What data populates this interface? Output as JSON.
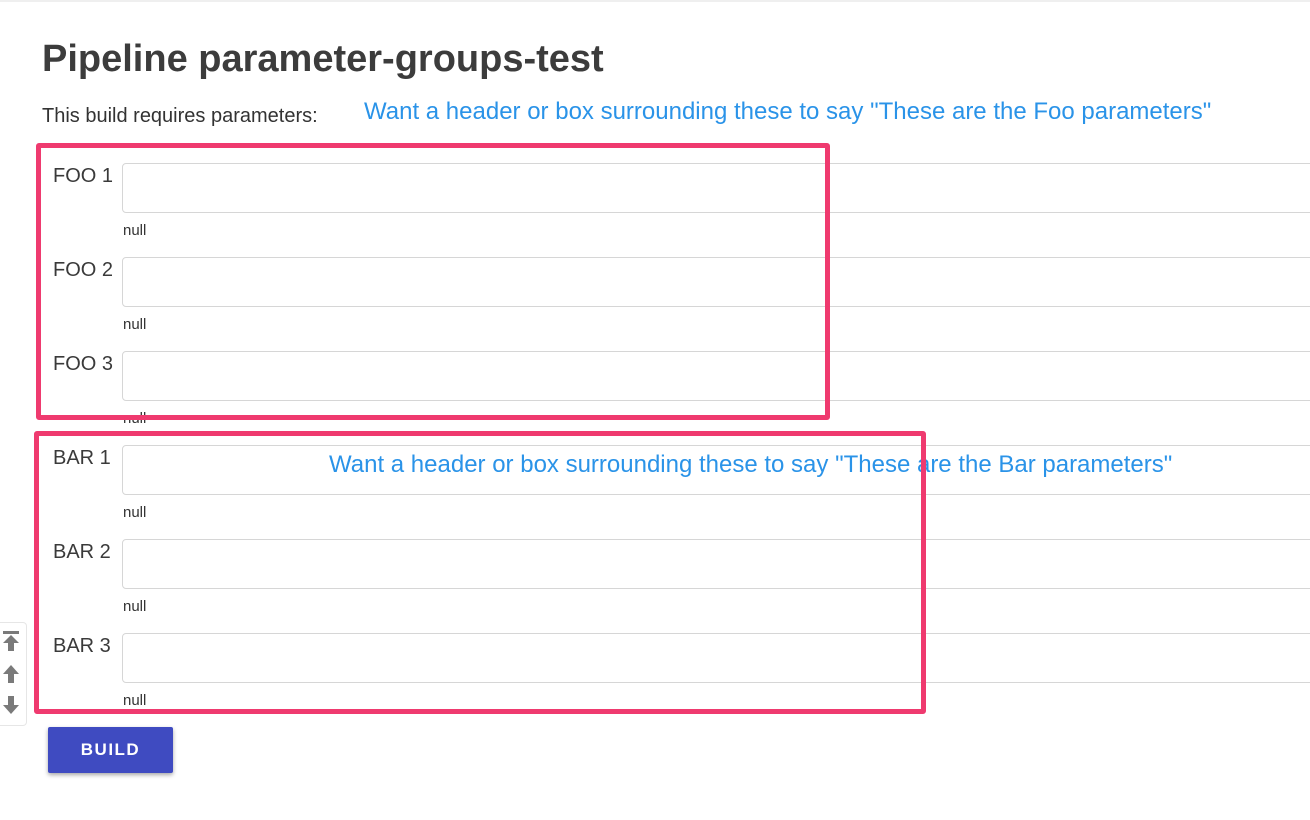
{
  "page": {
    "title": "Pipeline parameter-groups-test",
    "intro": "This build requires parameters:"
  },
  "annotations": {
    "foo": "Want a header or box surrounding these to say \"These are the Foo parameters\"",
    "bar": "Want a header or box surrounding these to say \"These are the Bar parameters\"",
    "color": "#2a93e8",
    "box_color": "#ef3a6f"
  },
  "parameters": [
    {
      "label": "FOO 1",
      "value": "",
      "description": "null"
    },
    {
      "label": "FOO 2",
      "value": "",
      "description": "null"
    },
    {
      "label": "FOO 3",
      "value": "",
      "description": "null"
    },
    {
      "label": "BAR 1",
      "value": "",
      "description": "null"
    },
    {
      "label": "BAR 2",
      "value": "",
      "description": "null"
    },
    {
      "label": "BAR 3",
      "value": "",
      "description": "null"
    }
  ],
  "scroll_controls": {
    "icons": [
      "scroll-to-top-icon",
      "scroll-up-icon",
      "scroll-down-icon"
    ]
  },
  "actions": {
    "build_label": "BUILD",
    "build_color": "#3f4bc1"
  }
}
